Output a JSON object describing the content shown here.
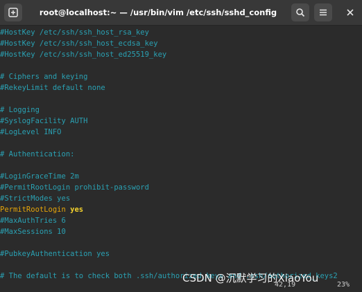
{
  "window": {
    "title": "root@localhost:~ — /usr/bin/vim /etc/ssh/sshd_config"
  },
  "titlebar_icons": {
    "new_tab": "new-tab-icon",
    "search": "search-icon",
    "menu": "hamburger-menu-icon",
    "close": "close-icon"
  },
  "editor": {
    "lines": [
      {
        "text": "#HostKey /etc/ssh/ssh_host_rsa_key",
        "kind": "comment"
      },
      {
        "text": "#HostKey /etc/ssh/ssh_host_ecdsa_key",
        "kind": "comment"
      },
      {
        "text": "#HostKey /etc/ssh/ssh_host_ed25519_key",
        "kind": "comment"
      },
      {
        "text": "",
        "kind": "blank"
      },
      {
        "text": "# Ciphers and keying",
        "kind": "comment"
      },
      {
        "text": "#RekeyLimit default none",
        "kind": "comment"
      },
      {
        "text": "",
        "kind": "blank"
      },
      {
        "text": "# Logging",
        "kind": "comment"
      },
      {
        "text": "#SyslogFacility AUTH",
        "kind": "comment"
      },
      {
        "text": "#LogLevel INFO",
        "kind": "comment"
      },
      {
        "text": "",
        "kind": "blank"
      },
      {
        "text": "# Authentication:",
        "kind": "comment"
      },
      {
        "text": "",
        "kind": "blank"
      },
      {
        "text": "#LoginGraceTime 2m",
        "kind": "comment"
      },
      {
        "text": "#PermitRootLogin prohibit-password",
        "kind": "comment"
      },
      {
        "text": "#StrictModes yes",
        "kind": "comment"
      },
      {
        "keyword": "PermitRootLogin",
        "value": "yes",
        "kind": "directive"
      },
      {
        "text": "#MaxAuthTries 6",
        "kind": "comment"
      },
      {
        "text": "#MaxSessions 10",
        "kind": "comment"
      },
      {
        "text": "",
        "kind": "blank"
      },
      {
        "text": "#PubkeyAuthentication yes",
        "kind": "comment"
      },
      {
        "text": "",
        "kind": "blank"
      },
      {
        "text": "# The default is to check both .ssh/authorized_keys and .ssh/authorized_keys2",
        "kind": "comment"
      }
    ]
  },
  "status": {
    "position": "42,19",
    "percent": "23%"
  },
  "watermark": "CSDN @沉默学习的XiaoYou",
  "colors": {
    "comment": "#2aa1b3",
    "keyword": "#e5a50a",
    "value": "#f6d32d",
    "background": "#2b2b2b",
    "titlebar": "#383838"
  }
}
